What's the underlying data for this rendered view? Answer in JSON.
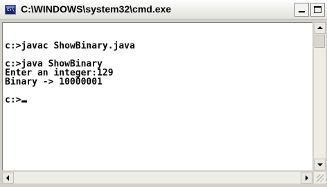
{
  "window": {
    "title": "C:\\WINDOWS\\system32\\cmd.exe",
    "icon": "cmd-app-icon"
  },
  "console": {
    "lines": [
      "c:>javac ShowBinary.java",
      "",
      "c:>java ShowBinary",
      "Enter an integer:129",
      "Binary -> 10000001",
      "",
      "c:>"
    ],
    "text_color": "#000000",
    "background": "#ffffff"
  },
  "colors": {
    "frame": "#d4d0c8",
    "titlebar": "#f1f1ee"
  }
}
